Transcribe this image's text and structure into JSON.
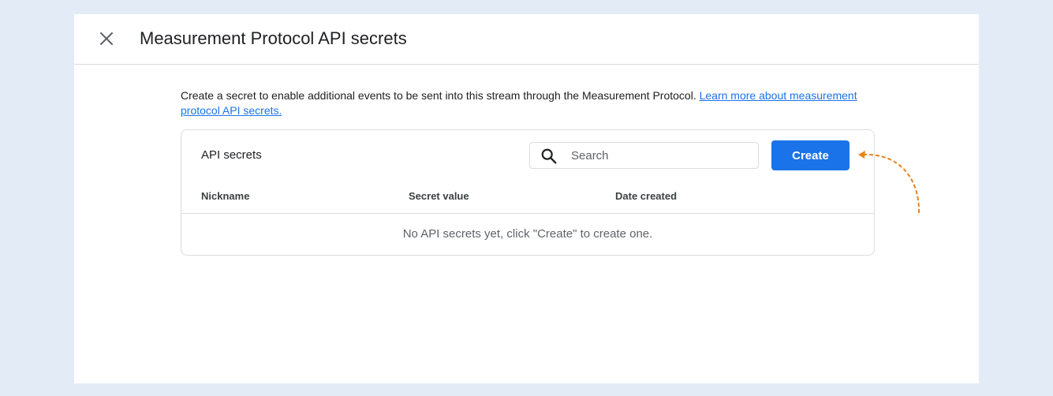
{
  "dialog": {
    "title": "Measurement Protocol API secrets",
    "close_icon": "close-icon"
  },
  "description": {
    "text": "Create a secret to enable additional events to be sent into this stream through the Measurement Protocol.",
    "link_text": "Learn more about measurement protocol API secrets."
  },
  "card": {
    "title": "API secrets",
    "search": {
      "placeholder": "Search",
      "value": "",
      "icon": "search-icon"
    },
    "create_label": "Create",
    "columns": [
      "Nickname",
      "Secret value",
      "Date created"
    ],
    "empty_message": "No API secrets yet, click \"Create\" to create one."
  },
  "colors": {
    "accent": "#1a73e8",
    "annotation": "#e8821e",
    "background": "#e3ecf6"
  }
}
